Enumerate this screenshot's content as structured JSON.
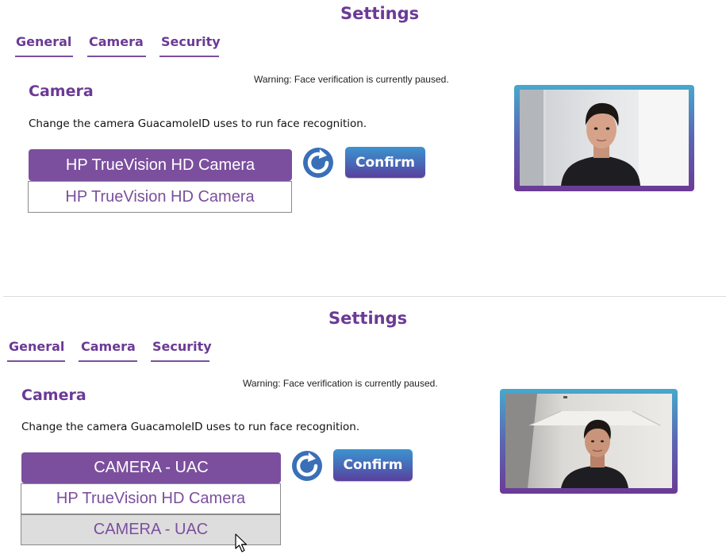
{
  "colors": {
    "accent": "#7b4f9e",
    "title": "#6b3a96",
    "confirm_gradient": [
      "#3c93cf",
      "#4a63b4",
      "#5a3f9c"
    ],
    "camera_frame_gradient": [
      "#47a9cd",
      "#5b66b2",
      "#6b3a96"
    ],
    "option_hover": "#dddddd"
  },
  "panels": [
    {
      "title": "Settings",
      "tabs": [
        {
          "label": "General"
        },
        {
          "label": "Camera"
        },
        {
          "label": "Security"
        }
      ],
      "warning": "Warning: Face verification is currently paused.",
      "section_heading": "Camera",
      "description": "Change the camera GuacamoleID uses to run face recognition.",
      "selected_camera": "HP TrueVision HD Camera",
      "dropdown_options": [
        {
          "label": "HP TrueVision HD Camera",
          "hovered": false
        }
      ],
      "refresh_icon": "refresh-icon",
      "confirm_label": "Confirm",
      "preview_icon": "webcam-preview"
    },
    {
      "title": "Settings",
      "tabs": [
        {
          "label": "General"
        },
        {
          "label": "Camera"
        },
        {
          "label": "Security"
        }
      ],
      "warning": "Warning: Face verification is currently paused.",
      "section_heading": "Camera",
      "description": "Change the camera GuacamoleID uses to run face recognition.",
      "selected_camera": "CAMERA - UAC",
      "dropdown_options": [
        {
          "label": "HP TrueVision HD Camera",
          "hovered": false
        },
        {
          "label": "CAMERA - UAC",
          "hovered": true
        }
      ],
      "refresh_icon": "refresh-icon",
      "confirm_label": "Confirm",
      "preview_icon": "webcam-preview",
      "cursor_icon": "mouse-pointer-icon"
    }
  ]
}
